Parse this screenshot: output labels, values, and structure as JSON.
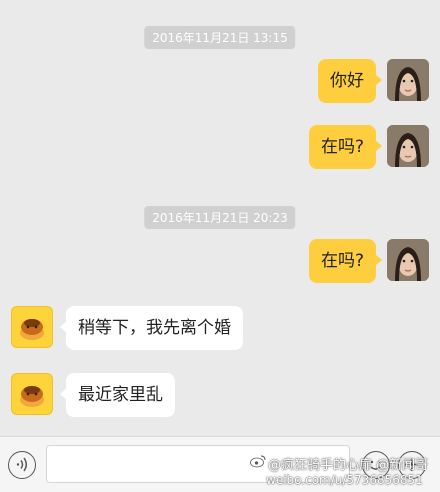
{
  "messages": {
    "ts1": "2016年11月21日 13:15",
    "m1": "你好",
    "m2": "在吗?",
    "ts2": "2016年11月21日 20:23",
    "m3": "在吗?",
    "m4": "稍等下，我先离个婚",
    "m5": "最近家里乱"
  },
  "icons": {
    "voice": "voice-icon",
    "emoji": "emoji-icon",
    "plus": "plus-icon",
    "weibo": "weibo-logo-icon"
  },
  "watermark": {
    "line1": "@疯狂骑手的心扉 @新闻哥",
    "line2": "weibo.com/u/5736856851"
  },
  "colors": {
    "outgoing_bubble": "#ffce3f",
    "incoming_bubble": "#ffffff",
    "background": "#eaeaea",
    "bot_avatar": "#ffd43b"
  }
}
